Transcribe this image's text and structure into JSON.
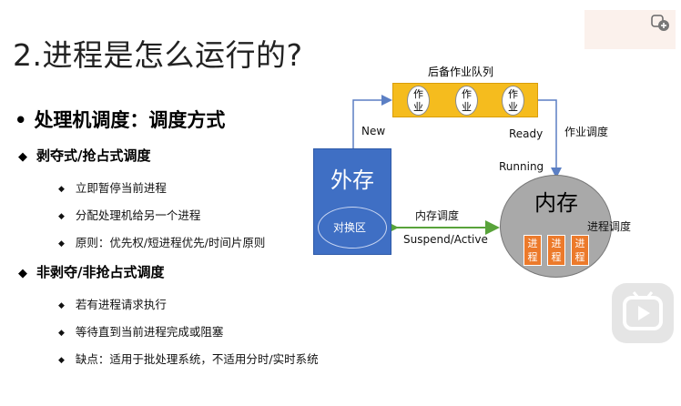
{
  "title": "2.进程是怎么运行的?",
  "section": {
    "bullet": "•",
    "heading": "处理机调度：调度方式"
  },
  "groups": [
    {
      "heading": "剥夺式/抢占式调度",
      "items": [
        "立即暂停当前进程",
        "分配处理机给另一个进程",
        "原则：优先权/短进程优先/时间片原则"
      ]
    },
    {
      "heading": "非剥夺/非抢占式调度",
      "items": [
        "若有进程请求执行",
        "等待直到当前进程完成或阻塞",
        "缺点：适用于批处理系统，不适用分时/实时系统"
      ]
    }
  ],
  "diagram": {
    "queue_label": "后备作业队列",
    "job": "作\n业",
    "external_storage": "外存",
    "swap_area": "对换区",
    "memory": "内存",
    "process": "进\n程",
    "labels": {
      "new": "New",
      "ready": "Ready",
      "running": "Running",
      "job_scheduling": "作业调度",
      "memory_scheduling": "内存调度",
      "suspend_active": "Suspend/Active",
      "process_scheduling": "进程调度"
    }
  },
  "icons": {
    "corner": "add-to-collection-icon",
    "play": "play-icon"
  },
  "colors": {
    "queue_fill": "#f5bc1e",
    "external_fill": "#3f6fc4",
    "memory_fill": "#a9a9a9",
    "process_fill": "#ec7a2b",
    "arrow_green": "#58a33a",
    "arrow_blue": "#5b7fc4"
  }
}
